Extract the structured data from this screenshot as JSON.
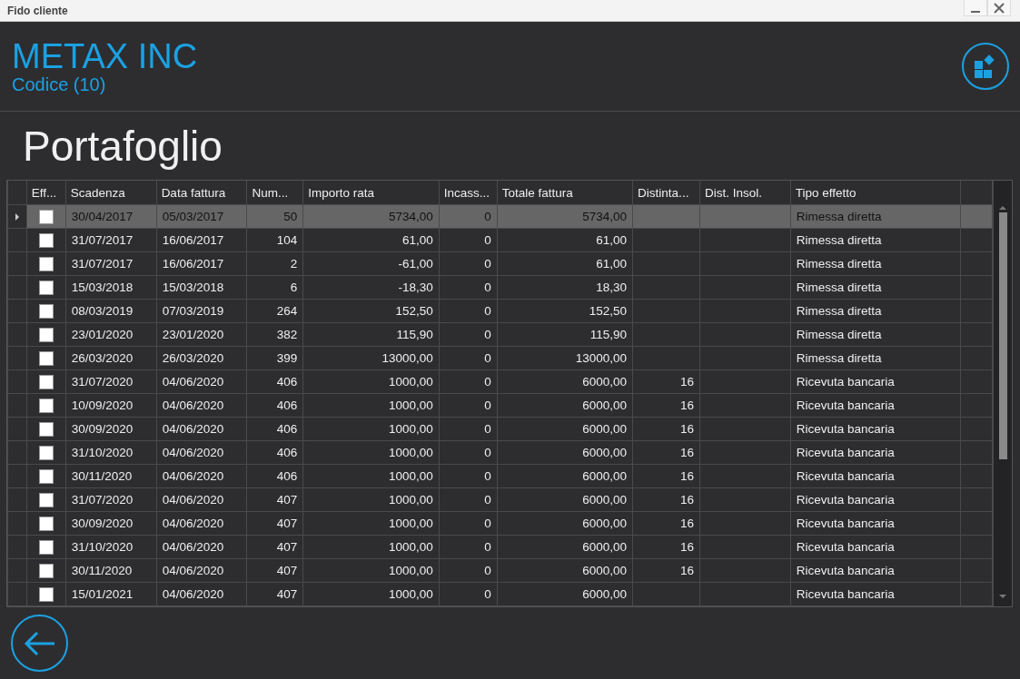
{
  "window": {
    "title": "Fido cliente"
  },
  "header": {
    "company": "METAX INC",
    "code": "Codice (10)"
  },
  "page_title": "Portafoglio",
  "table": {
    "columns": [
      {
        "label": "Eff...",
        "kind": "check"
      },
      {
        "label": "Scadenza",
        "kind": "text"
      },
      {
        "label": "Data fattura",
        "kind": "text"
      },
      {
        "label": "Num...",
        "kind": "number"
      },
      {
        "label": "Importo rata",
        "kind": "number"
      },
      {
        "label": "Incass...",
        "kind": "number"
      },
      {
        "label": "Totale fattura",
        "kind": "number"
      },
      {
        "label": "Distinta...",
        "kind": "number"
      },
      {
        "label": "Dist. Insol.",
        "kind": "number"
      },
      {
        "label": "Tipo effetto",
        "kind": "text"
      }
    ],
    "rows": [
      {
        "selected": true,
        "checked": false,
        "cells": [
          null,
          "30/04/2017",
          "05/03/2017",
          "50",
          "5734,00",
          "0",
          "5734,00",
          null,
          null,
          "Rimessa diretta"
        ]
      },
      {
        "selected": false,
        "checked": false,
        "cells": [
          null,
          "31/07/2017",
          "16/06/2017",
          "104",
          "61,00",
          "0",
          "61,00",
          null,
          null,
          "Rimessa diretta"
        ]
      },
      {
        "selected": false,
        "checked": false,
        "cells": [
          null,
          "31/07/2017",
          "16/06/2017",
          "2",
          "-61,00",
          "0",
          "61,00",
          null,
          null,
          "Rimessa diretta"
        ]
      },
      {
        "selected": false,
        "checked": false,
        "cells": [
          null,
          "15/03/2018",
          "15/03/2018",
          "6",
          "-18,30",
          "0",
          "18,30",
          null,
          null,
          "Rimessa diretta"
        ]
      },
      {
        "selected": false,
        "checked": false,
        "cells": [
          null,
          "08/03/2019",
          "07/03/2019",
          "264",
          "152,50",
          "0",
          "152,50",
          null,
          null,
          "Rimessa diretta"
        ]
      },
      {
        "selected": false,
        "checked": false,
        "cells": [
          null,
          "23/01/2020",
          "23/01/2020",
          "382",
          "115,90",
          "0",
          "115,90",
          null,
          null,
          "Rimessa diretta"
        ]
      },
      {
        "selected": false,
        "checked": false,
        "cells": [
          null,
          "26/03/2020",
          "26/03/2020",
          "399",
          "13000,00",
          "0",
          "13000,00",
          null,
          null,
          "Rimessa diretta"
        ]
      },
      {
        "selected": false,
        "checked": false,
        "cells": [
          null,
          "31/07/2020",
          "04/06/2020",
          "406",
          "1000,00",
          "0",
          "6000,00",
          "16",
          null,
          "Ricevuta bancaria"
        ]
      },
      {
        "selected": false,
        "checked": false,
        "cells": [
          null,
          "10/09/2020",
          "04/06/2020",
          "406",
          "1000,00",
          "0",
          "6000,00",
          "16",
          null,
          "Ricevuta bancaria"
        ]
      },
      {
        "selected": false,
        "checked": false,
        "cells": [
          null,
          "30/09/2020",
          "04/06/2020",
          "406",
          "1000,00",
          "0",
          "6000,00",
          "16",
          null,
          "Ricevuta bancaria"
        ]
      },
      {
        "selected": false,
        "checked": false,
        "cells": [
          null,
          "31/10/2020",
          "04/06/2020",
          "406",
          "1000,00",
          "0",
          "6000,00",
          "16",
          null,
          "Ricevuta bancaria"
        ]
      },
      {
        "selected": false,
        "checked": false,
        "cells": [
          null,
          "30/11/2020",
          "04/06/2020",
          "406",
          "1000,00",
          "0",
          "6000,00",
          "16",
          null,
          "Ricevuta bancaria"
        ]
      },
      {
        "selected": false,
        "checked": false,
        "cells": [
          null,
          "31/07/2020",
          "04/06/2020",
          "407",
          "1000,00",
          "0",
          "6000,00",
          "16",
          null,
          "Ricevuta bancaria"
        ]
      },
      {
        "selected": false,
        "checked": false,
        "cells": [
          null,
          "30/09/2020",
          "04/06/2020",
          "407",
          "1000,00",
          "0",
          "6000,00",
          "16",
          null,
          "Ricevuta bancaria"
        ]
      },
      {
        "selected": false,
        "checked": false,
        "cells": [
          null,
          "31/10/2020",
          "04/06/2020",
          "407",
          "1000,00",
          "0",
          "6000,00",
          "16",
          null,
          "Ricevuta bancaria"
        ]
      },
      {
        "selected": false,
        "checked": false,
        "cells": [
          null,
          "30/11/2020",
          "04/06/2020",
          "407",
          "1000,00",
          "0",
          "6000,00",
          "16",
          null,
          "Ricevuta bancaria"
        ]
      },
      {
        "selected": false,
        "checked": false,
        "cells": [
          null,
          "15/01/2021",
          "04/06/2020",
          "407",
          "1000,00",
          "0",
          "6000,00",
          null,
          null,
          "Ricevuta bancaria"
        ]
      }
    ]
  }
}
